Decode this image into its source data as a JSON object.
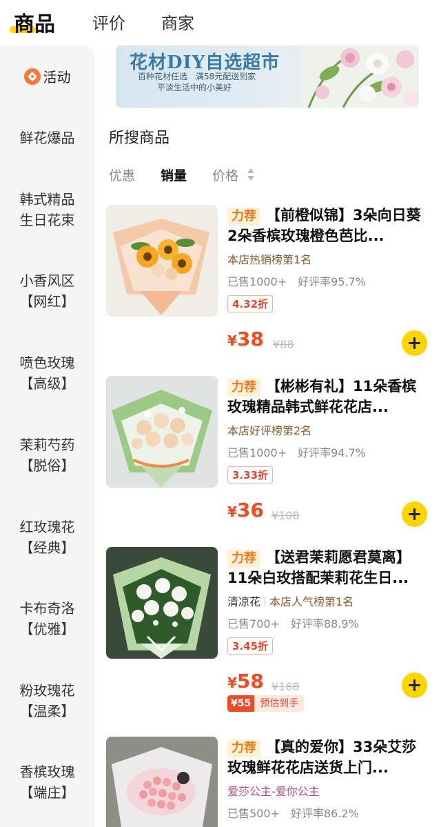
{
  "tabs": [
    {
      "label": "商品",
      "active": true
    },
    {
      "label": "评价",
      "active": false
    },
    {
      "label": "商家",
      "active": false
    }
  ],
  "sidebar": {
    "items": [
      {
        "label": "活动",
        "icon": "activity-tag-icon"
      },
      {
        "label": "鲜花爆品"
      },
      {
        "label_line1": "韩式精品",
        "label_line2": "生日花束"
      },
      {
        "label_line1": "小香风区",
        "label_line2": "【网红】"
      },
      {
        "label_line1": "喷色玫瑰",
        "label_line2": "【高级】"
      },
      {
        "label_line1": "茉莉芍药",
        "label_line2": "【脱俗】"
      },
      {
        "label_line1": "红玫瑰花",
        "label_line2": "【经典】"
      },
      {
        "label_line1": "卡布奇洛",
        "label_line2": "【优雅】"
      },
      {
        "label_line1": "粉玫瑰花",
        "label_line2": "【温柔】"
      },
      {
        "label_line1": "香槟玫瑰",
        "label_line2": "【端庄】"
      }
    ]
  },
  "banner": {
    "title": "花材DIY自选超市",
    "subtitle1": "百种花材任选　满58元配送到家",
    "subtitle2": "平淡生活中的小美好"
  },
  "section_title": "所搜商品",
  "sort": {
    "discount": "优惠",
    "sales": "销量",
    "price": "价格"
  },
  "products": [
    {
      "tag": "力荐",
      "name": "【前橙似锦】3朵向日葵2朵香槟玫瑰橙色芭比...",
      "shop": "",
      "rank": "本店热销榜第1名",
      "sold": "已售1000+",
      "rating": "好评率95.7%",
      "discount": "4.32折",
      "price": "38",
      "original_price": "¥88"
    },
    {
      "tag": "力荐",
      "name": "【彬彬有礼】11朵香槟玫瑰精品韩式鲜花花店...",
      "shop": "",
      "rank": "本店好评榜第2名",
      "sold": "已售1000+",
      "rating": "好评率94.7%",
      "discount": "3.33折",
      "price": "36",
      "original_price": "¥108"
    },
    {
      "tag": "力荐",
      "name": "【送君茉莉愿君莫离】11朵白玫搭配茉莉花生日...",
      "shop": "清凉花",
      "rank": "本店人气榜第1名",
      "sold": "已售700+",
      "rating": "好评率88.9%",
      "discount": "3.45折",
      "price": "58",
      "original_price": "¥168",
      "coupon_amount": "¥55",
      "coupon_label": "预估到手"
    },
    {
      "tag": "力荐",
      "name": "【真的爱你】33朵艾莎玫瑰鲜花花店送货上门...",
      "shop": "",
      "rank": "爱莎公主-爱你公主",
      "sold": "已售500+",
      "rating": "好评率86.2%"
    }
  ],
  "currency_symbol": "¥",
  "colors": {
    "accent": "#ffd400",
    "price": "#f04b1f",
    "tag_bg": "#fff1d6",
    "tag_text": "#f07a1c"
  }
}
